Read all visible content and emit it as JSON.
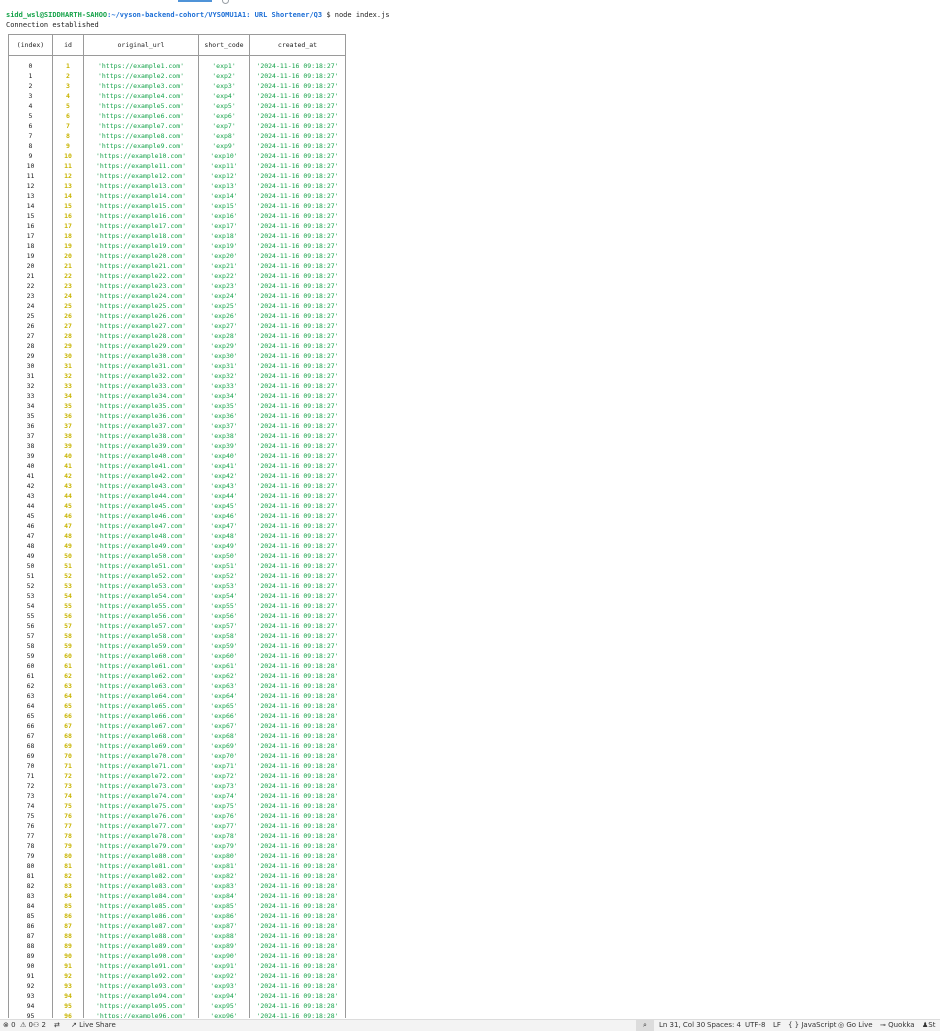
{
  "terminal": {
    "prompt_user": "sidd_wsl@SIDDHARTH-SAHOO",
    "prompt_path": ":~/vyson-backend-cohort/VYSOMU1A1: URL Shortener/Q3",
    "prompt_cmd": "$ node index.js",
    "output_line": "Connection established"
  },
  "table": {
    "headers": [
      "(index)",
      "id",
      "original_url",
      "short_code",
      "created_at"
    ],
    "timestamp_a": "'2024-11-16 09:18:27'",
    "timestamp_b": "'2024-11-16 09:18:28'",
    "switch_at_id": 61,
    "row_count": 96
  },
  "statusbar": {
    "problems": "⊗ 0  ⚠ 0",
    "ports": "⚇ 2",
    "live_share": "Live Share",
    "cursor": "Ln 31, Col 30",
    "spaces": "Spaces: 4",
    "encoding": "UTF-8",
    "eol": "LF",
    "language": "{ } JavaScript",
    "go_live": "Go Live",
    "quokka": "Quokka",
    "overflow": "St"
  },
  "colors": {
    "id_yellow": "#c8b400",
    "string_green": "#16a34a",
    "path_blue": "#1d6fd6"
  }
}
